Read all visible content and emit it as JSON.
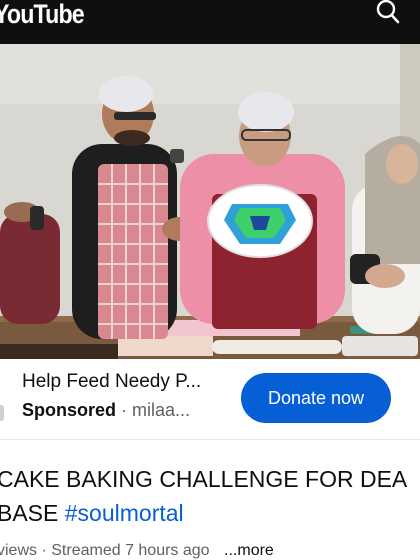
{
  "topbar": {
    "brand": "YouTube",
    "search_icon": "search-icon"
  },
  "promo": {
    "title": "Help Feed Needy P...",
    "sponsored": "Sponsored",
    "separator": "·",
    "advertiser": "milaa...",
    "donate_label": "Donate now"
  },
  "video": {
    "title_main": "CAKE BAKING CHALLENGE FOR DEA",
    "title_line2": "BASE",
    "hashtag": "#soulmortal",
    "views": "views",
    "separator": "·",
    "streamed": "Streamed 7 hours ago",
    "more": "...more"
  },
  "colors": {
    "topbar": "#0f0f0f",
    "accent": "#065fd4",
    "secondary_text": "#606060"
  }
}
